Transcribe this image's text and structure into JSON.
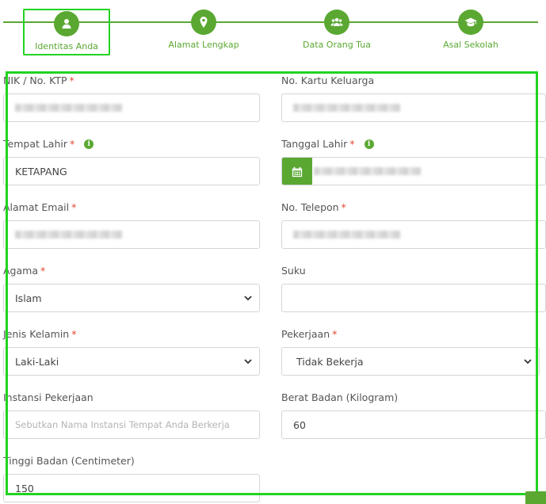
{
  "steps": [
    {
      "label": "Identitas Anda",
      "icon": "user-icon",
      "active": true
    },
    {
      "label": "Alamat Lengkap",
      "icon": "map-marker-icon",
      "active": false
    },
    {
      "label": "Data Orang Tua",
      "icon": "group-icon",
      "active": false
    },
    {
      "label": "Asal Sekolah",
      "icon": "graduation-cap-icon",
      "active": false
    }
  ],
  "form": {
    "nik": {
      "label": "NIK / No. KTP",
      "required": "*",
      "value": ""
    },
    "kk": {
      "label": "No. Kartu Keluarga",
      "value": ""
    },
    "tempat_lahir": {
      "label": "Tempat Lahir",
      "required": "*",
      "value": "KETAPANG"
    },
    "tanggal_lahir": {
      "label": "Tanggal Lahir",
      "required": "*",
      "value": ""
    },
    "email": {
      "label": "Alamat Email",
      "required": "*",
      "value": ""
    },
    "telepon": {
      "label": "No. Telepon",
      "required": "*",
      "value": ""
    },
    "agama": {
      "label": "Agama",
      "required": "*",
      "value": "Islam"
    },
    "suku": {
      "label": "Suku",
      "value": ""
    },
    "jenis_kelamin": {
      "label": "Jenis Kelamin",
      "required": "*",
      "value": "Laki-Laki"
    },
    "pekerjaan": {
      "label": "Pekerjaan",
      "required": "*",
      "value": "Tidak Bekerja"
    },
    "instansi": {
      "label": "Instansi Pekerjaan",
      "placeholder": "Sebutkan Nama Instansi Tempat Anda Berkerja"
    },
    "berat": {
      "label": "Berat Badan (Kilogram)",
      "value": "60"
    },
    "tinggi": {
      "label": "Tinggi Badan (Centimeter)",
      "value": "150"
    }
  },
  "colors": {
    "accent": "#5aa832",
    "highlight": "#22d322",
    "required": "#e2472e"
  }
}
